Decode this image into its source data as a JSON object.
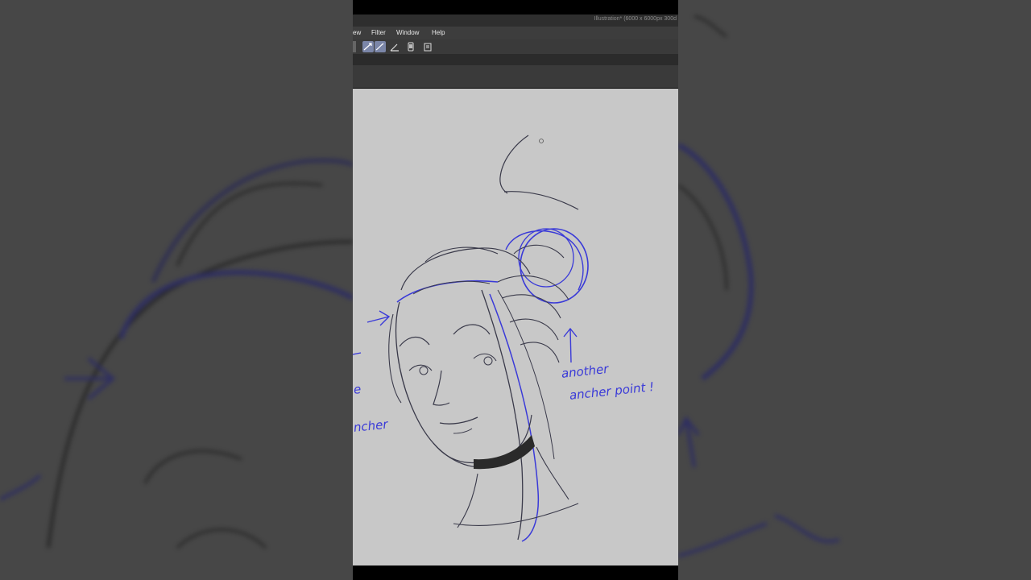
{
  "app": {
    "document_title": "Illustration* (6000 x 6000px 300d",
    "menu": [
      {
        "label": "ew"
      },
      {
        "label": "Filter"
      },
      {
        "label": "Window"
      },
      {
        "label": "Help"
      }
    ]
  },
  "toolbar": {
    "tools": [
      {
        "icon": "pen-stroke-icon",
        "active": true
      },
      {
        "icon": "brush-stroke-icon",
        "active": true
      },
      {
        "icon": "ruler-icon",
        "active": false
      },
      {
        "icon": "device-icon",
        "active": false
      },
      {
        "icon": "clipboard-icon",
        "active": false
      }
    ]
  },
  "canvas": {
    "annotations": {
      "another": "another",
      "anchor_point": "ancher point !",
      "left_e": "e",
      "left_anchor": "ncher"
    },
    "colors": {
      "paper": "#c8c8c8",
      "sketch_dark": "#3a3a4a",
      "sketch_blue": "#3a3ad8"
    }
  }
}
